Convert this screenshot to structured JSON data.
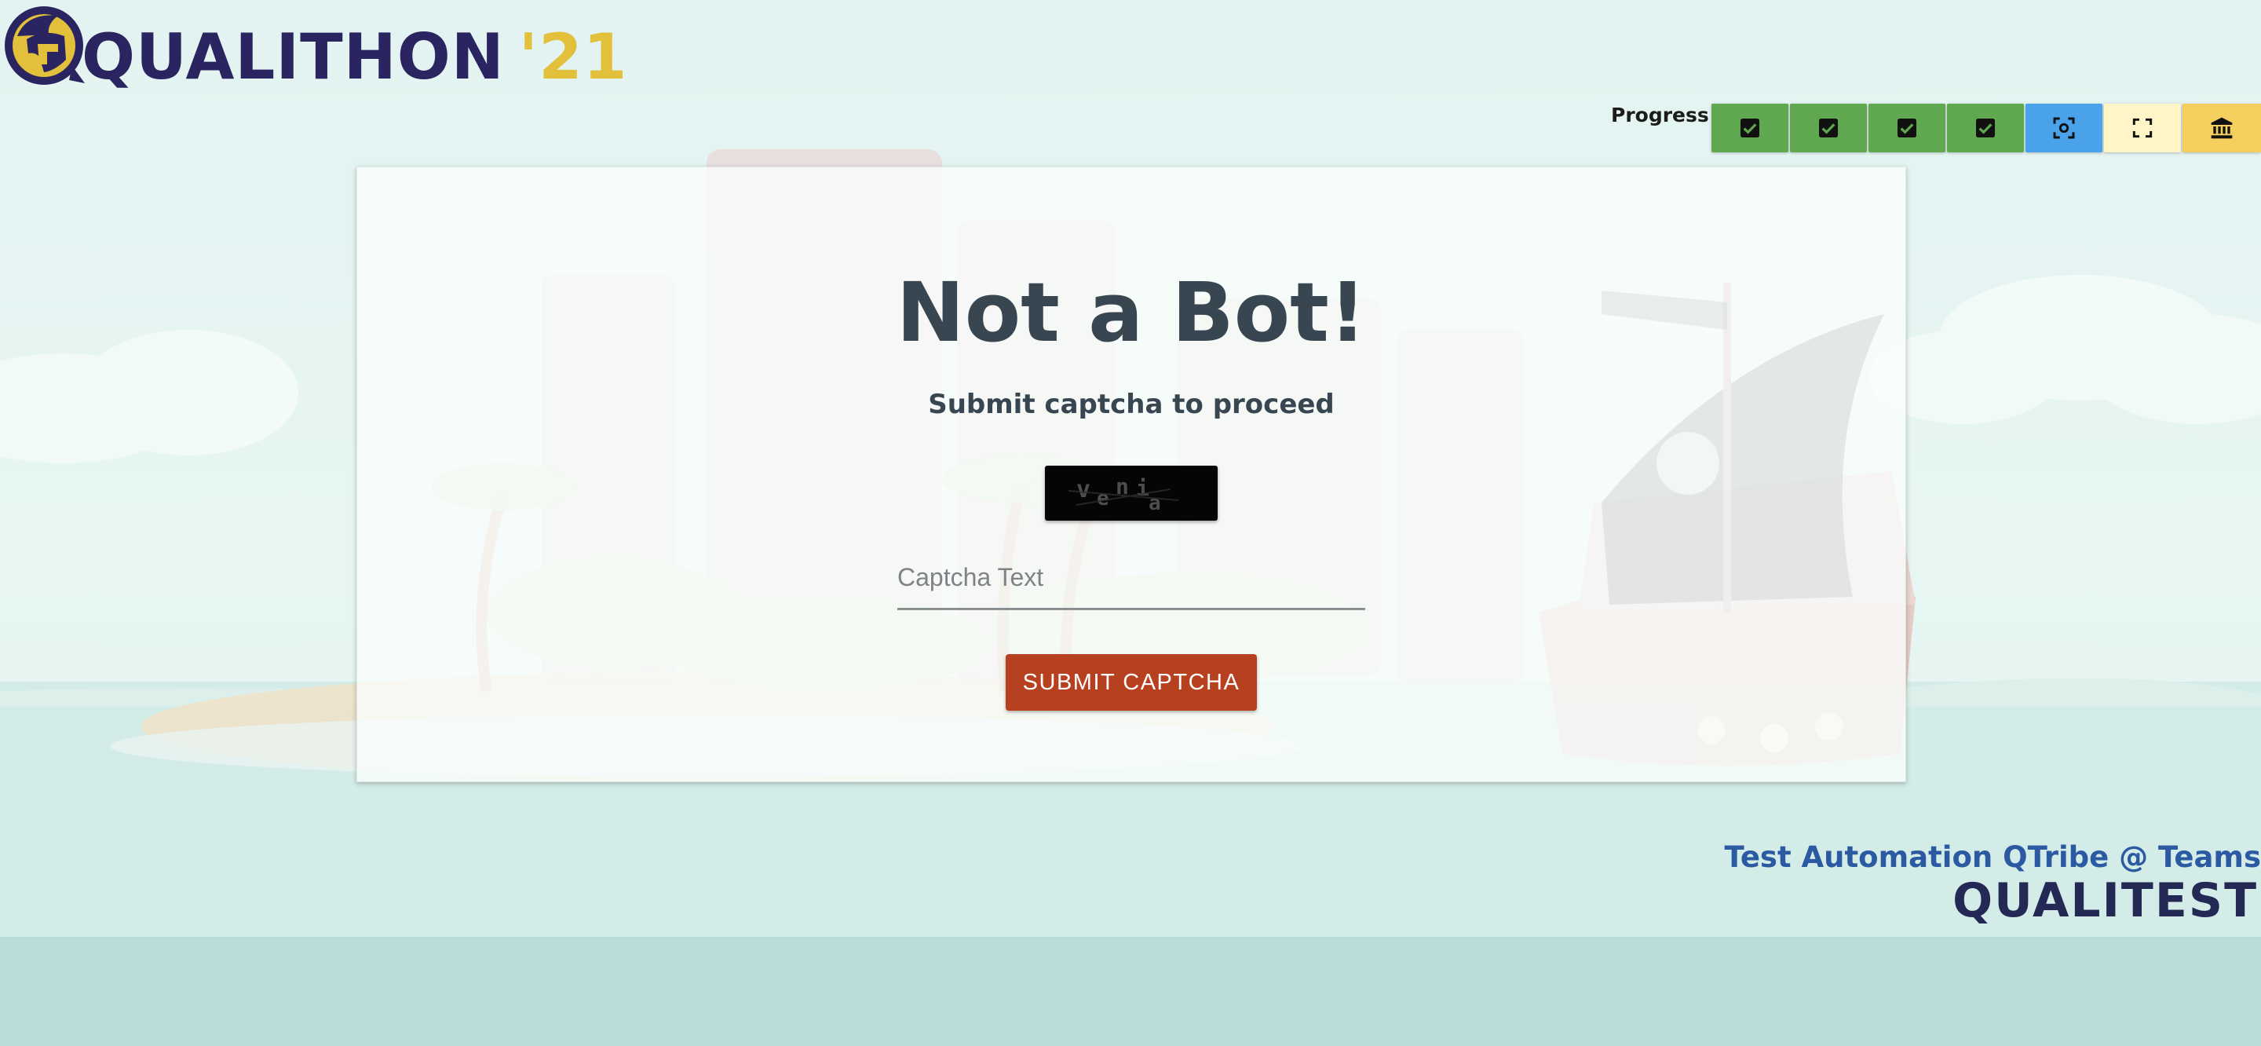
{
  "logo": {
    "name": "QUALITHON",
    "year": "'21",
    "colors": {
      "name": "#2a2560",
      "year": "#e3c03c"
    }
  },
  "progress": {
    "label": "Progress",
    "steps": [
      {
        "icon": "check-box-icon",
        "state": "completed",
        "color": "#5fa84f"
      },
      {
        "icon": "check-box-icon",
        "state": "completed",
        "color": "#5fa84f"
      },
      {
        "icon": "check-box-icon",
        "state": "completed",
        "color": "#5fa84f"
      },
      {
        "icon": "check-box-icon",
        "state": "completed",
        "color": "#5fa84f"
      },
      {
        "icon": "center-focus-icon",
        "state": "current",
        "color": "#4aa3ea"
      },
      {
        "icon": "fullscreen-icon",
        "state": "upcoming",
        "color": "#fff5c6"
      },
      {
        "icon": "bank-icon",
        "state": "upcoming",
        "color": "#f5cf5e"
      }
    ]
  },
  "card": {
    "title": "Not a Bot!",
    "subtitle": "Submit captcha to proceed",
    "captcha_text": "venia",
    "input": {
      "placeholder": "Captcha Text",
      "value": ""
    },
    "submit_label": "SUBMIT CAPTCHA",
    "colors": {
      "text": "#374650",
      "button": "#b7401f"
    }
  },
  "branding": {
    "team": "Test Automation QTribe @ Teams",
    "company": "QUALITEST"
  }
}
